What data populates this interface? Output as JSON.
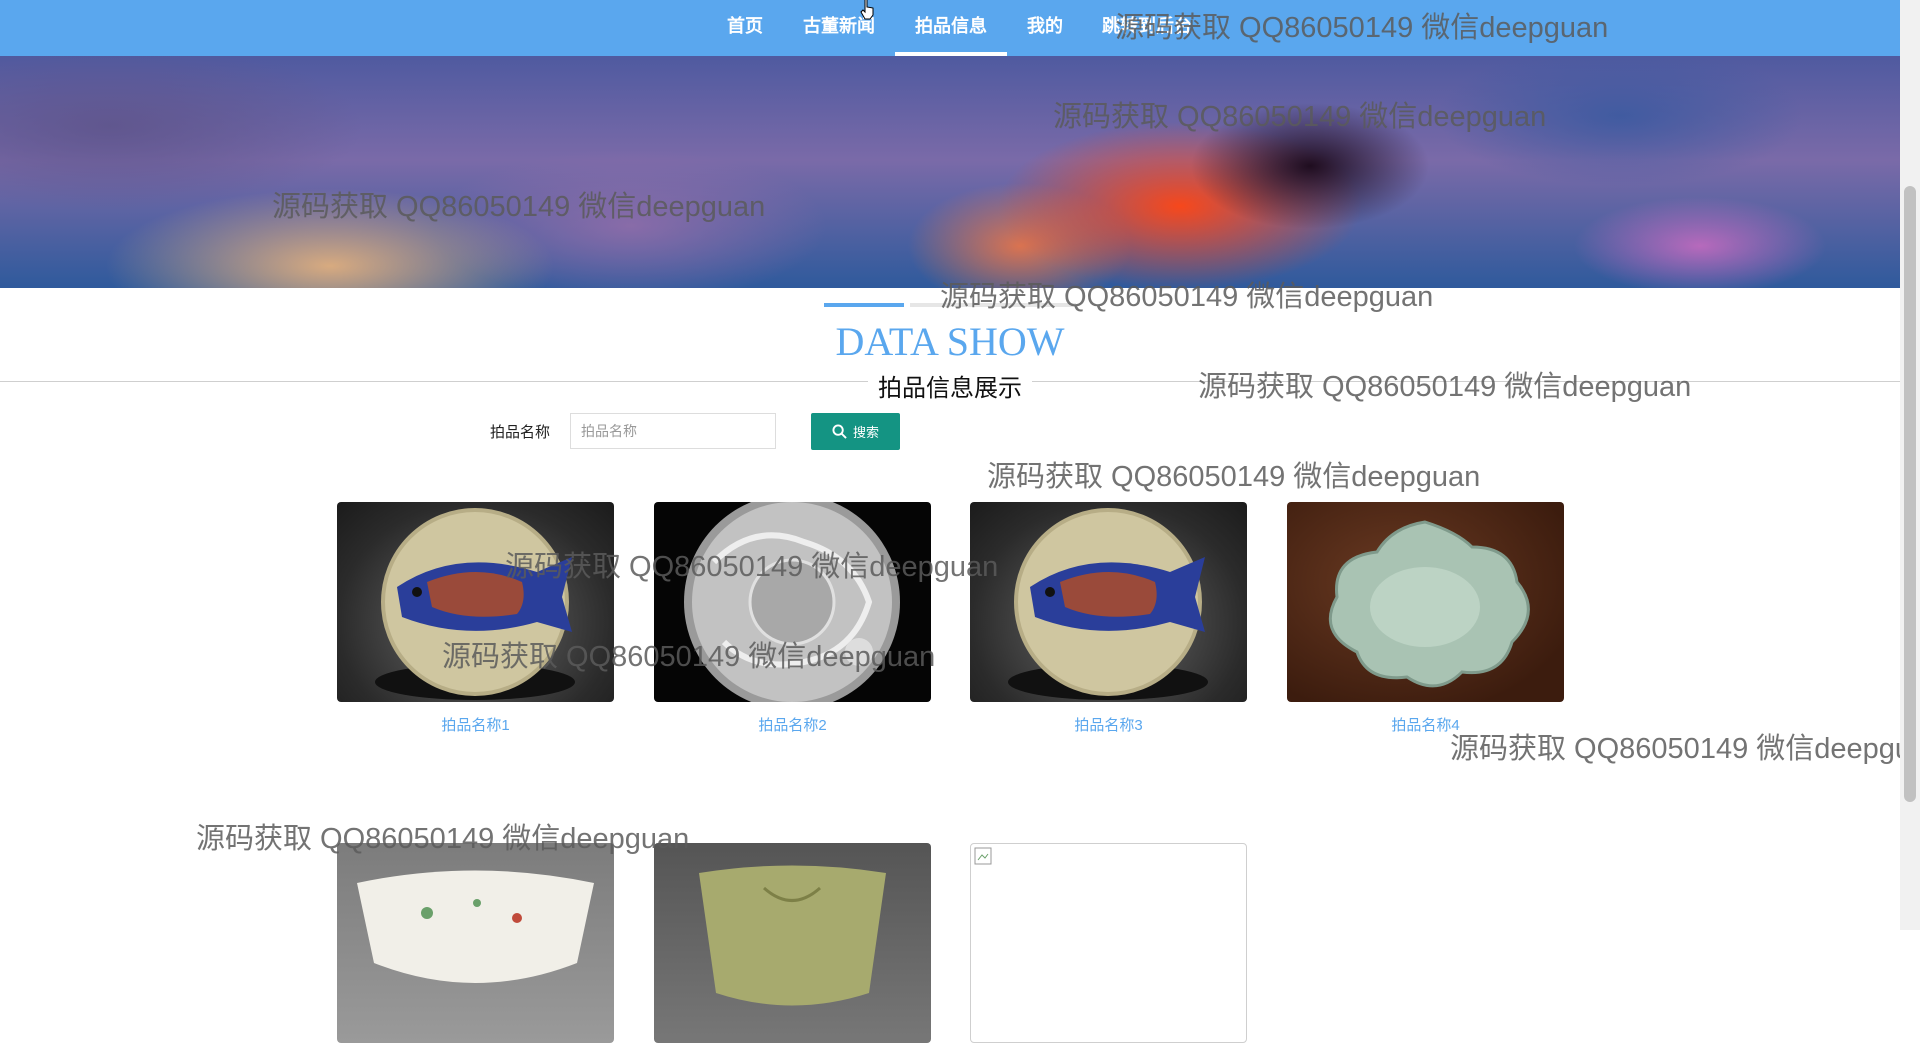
{
  "nav": {
    "items": [
      {
        "label": "首页",
        "active": false
      },
      {
        "label": "古董新闻",
        "active": false
      },
      {
        "label": "拍品信息",
        "active": true
      },
      {
        "label": "我的",
        "active": false
      },
      {
        "label": "跳转到后台",
        "active": false
      }
    ]
  },
  "section": {
    "title": "DATA SHOW",
    "subtitle": "拍品信息展示"
  },
  "search": {
    "label": "拍品名称",
    "placeholder": "拍品名称",
    "value": "",
    "button_label": "搜索"
  },
  "products": [
    {
      "name": "拍品名称1",
      "image": "fish-plate"
    },
    {
      "name": "拍品名称2",
      "image": "silver-dragon-plate"
    },
    {
      "name": "拍品名称3",
      "image": "fish-plate"
    },
    {
      "name": "拍品名称4",
      "image": "celadon-lotus-dish"
    },
    {
      "name": "",
      "image": "painted-bowl"
    },
    {
      "name": "",
      "image": "celadon-cup"
    },
    {
      "name": "",
      "image": "broken-image"
    }
  ],
  "watermark": "源码获取 QQ86050149 微信deepguan",
  "colors": {
    "nav_bg": "#5aa7ee",
    "accent": "#5aa7ee",
    "search_button": "#149483"
  }
}
